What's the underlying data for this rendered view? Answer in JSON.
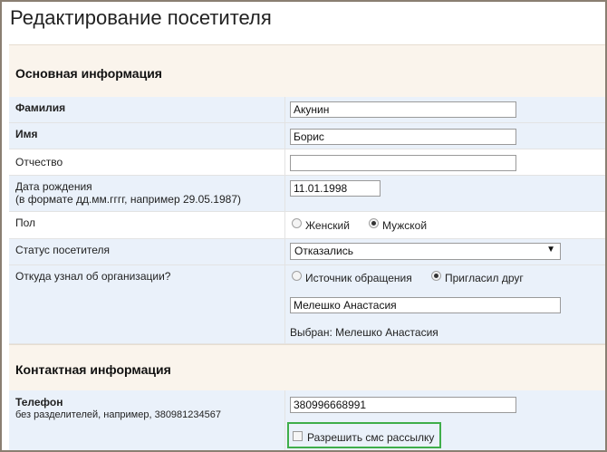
{
  "page": {
    "title": "Редактирование посетителя"
  },
  "sections": {
    "basic": "Основная информация",
    "contact": "Контактная информация"
  },
  "fields": {
    "last_name": {
      "label": "Фамилия",
      "value": "Акунин"
    },
    "first_name": {
      "label": "Имя",
      "value": "Борис"
    },
    "patronymic": {
      "label": "Отчество",
      "value": ""
    },
    "birth_date": {
      "label": "Дата рождения",
      "hint": "(в формате дд.мм.гггг, например 29.05.1987)",
      "value": "11.01.1998"
    },
    "gender": {
      "label": "Пол",
      "options": [
        "Женский",
        "Мужской"
      ],
      "selected": "Мужской"
    },
    "status": {
      "label": "Статус посетителя",
      "value": "Отказались"
    },
    "source": {
      "label": "Откуда узнал об организации?",
      "options": [
        "Источник обращения",
        "Пригласил друг"
      ],
      "selected": "Пригласил друг",
      "friend_value": "Мелешко Анастасия",
      "chosen_text": "Выбран: Мелешко Анастасия"
    },
    "phone": {
      "label": "Телефон",
      "hint": "без разделителей, например, 380981234567",
      "value": "380996668991",
      "sms_label": "Разрешить смс рассылку",
      "sms_checked": false
    }
  },
  "colors": {
    "highlight": "#3fae4a",
    "section_bg": "#faf4ec",
    "alt_row_bg": "#eaf1fa"
  }
}
